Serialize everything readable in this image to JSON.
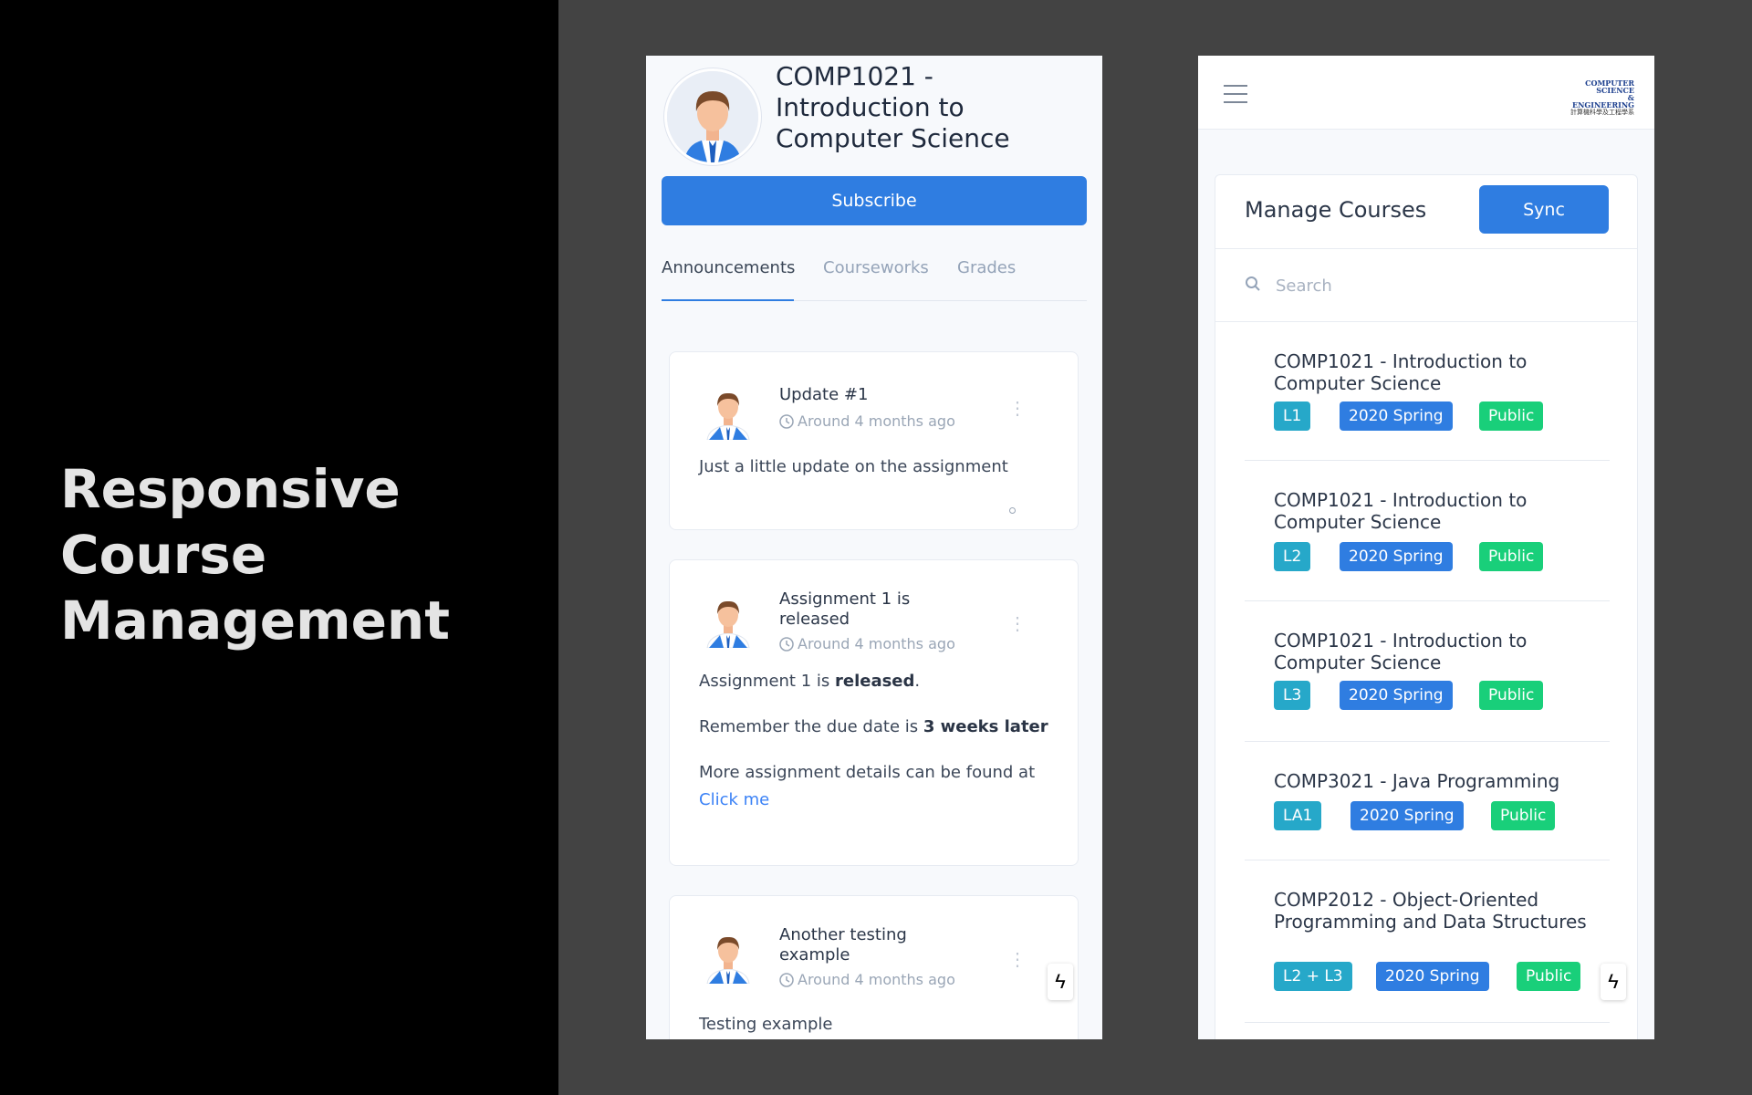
{
  "headline": {
    "line1": "Responsive",
    "line2": "Course",
    "line3": "Management"
  },
  "phone1": {
    "course_title": "COMP1021 - Introduction to Computer Science",
    "subscribe_label": "Subscribe",
    "tabs": [
      {
        "label": "Announcements"
      },
      {
        "label": "Courseworks"
      },
      {
        "label": "Grades"
      }
    ],
    "announcements": [
      {
        "title": "Update #1",
        "time": "Around 4 months ago",
        "body": "Just a little update on the assignment"
      },
      {
        "title": "Assignment 1 is released",
        "time": "Around 4 months ago",
        "line1_a": "Assignment 1 is ",
        "line1_b": "released",
        "line1_c": ".",
        "line2_a": "Remember the due date is ",
        "line2_b": "3 weeks later",
        "line3": "More assignment details can be found at",
        "link": "Click me"
      },
      {
        "title": "Another testing example",
        "time": "Around 4 months ago",
        "body": "Testing example"
      }
    ],
    "fab_icon": "lightning-icon"
  },
  "phone2": {
    "logo": {
      "line1": "COMPUTER SCIENCE",
      "line2": "& ENGINEERING",
      "line3": "計算機科學及工程學系"
    },
    "panel_title": "Manage Courses",
    "sync_label": "Sync",
    "search_placeholder": "Search",
    "courses": [
      {
        "title": "COMP1021 - Introduction to Computer Science",
        "section": "L1",
        "term": "2020 Spring",
        "visibility": "Public"
      },
      {
        "title": "COMP1021 - Introduction to Computer Science",
        "section": "L2",
        "term": "2020 Spring",
        "visibility": "Public"
      },
      {
        "title": "COMP1021 - Introduction to Computer Science",
        "section": "L3",
        "term": "2020 Spring",
        "visibility": "Public"
      },
      {
        "title": "COMP3021 - Java Programming",
        "section": "LA1",
        "term": "2020 Spring",
        "visibility": "Public"
      },
      {
        "title": "COMP2012 - Object-Oriented Programming and Data Structures",
        "section": "L2 + L3",
        "term": "2020 Spring",
        "visibility": "Public"
      }
    ],
    "fab_icon": "lightning-icon"
  },
  "colors": {
    "primary": "#2f7de1",
    "section_badge": "#26a8c9",
    "public_badge": "#19cf7a",
    "background": "#434343"
  }
}
